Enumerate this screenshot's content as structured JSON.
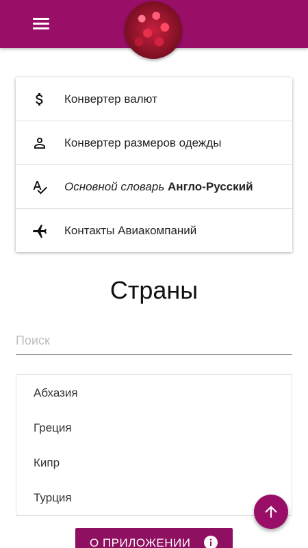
{
  "header": {
    "menu_icon": "hamburger-menu-icon",
    "avatar": "raspberry-avatar",
    "accent_color": "#990f67"
  },
  "menu": {
    "items": [
      {
        "icon": "dollar-icon",
        "label": "Конвертер валют"
      },
      {
        "icon": "person-icon",
        "label": "Конвертер размеров одежды"
      },
      {
        "icon": "spellcheck-icon",
        "label_italic": "Основной словарь",
        "label_bold": "Англо-Русский"
      },
      {
        "icon": "airplane-icon",
        "label": "Контакты Авиакомпаний"
      }
    ]
  },
  "countries": {
    "title": "Страны",
    "search_placeholder": "Поиск",
    "items": [
      "Абхазия",
      "Греция",
      "Кипр",
      "Турция"
    ]
  },
  "fab": {
    "icon": "arrow-up-icon"
  },
  "about": {
    "label": "О ПРИЛОЖЕНИИ",
    "icon": "info-icon"
  }
}
